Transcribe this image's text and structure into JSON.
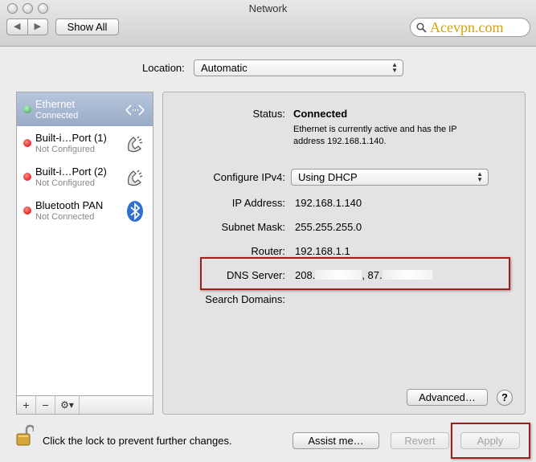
{
  "window": {
    "title": "Network",
    "back_label": "◀",
    "forward_label": "▶",
    "show_all_label": "Show All",
    "search_value": "Acevpn.com"
  },
  "location": {
    "label": "Location:",
    "value": "Automatic"
  },
  "sidebar": {
    "items": [
      {
        "name": "Ethernet",
        "status": "Connected",
        "state": "green",
        "icon": "ethernet-arrows-icon"
      },
      {
        "name": "Built-i…Port (1)",
        "status": "Not Configured",
        "state": "red",
        "icon": "phone-icon"
      },
      {
        "name": "Built-i…Port (2)",
        "status": "Not Configured",
        "state": "red",
        "icon": "phone-icon"
      },
      {
        "name": "Bluetooth PAN",
        "status": "Not Connected",
        "state": "red",
        "icon": "bluetooth-icon"
      }
    ],
    "footer": {
      "add": "+",
      "remove": "−",
      "gear": "⚙▾"
    }
  },
  "detail": {
    "status_label": "Status:",
    "status_value": "Connected",
    "status_desc_1": "Ethernet is currently active and has the IP",
    "status_desc_2": "address 192.168.1.140.",
    "configure_label": "Configure IPv4:",
    "configure_value": "Using DHCP",
    "ip_label": "IP Address:",
    "ip_value": "192.168.1.140",
    "subnet_label": "Subnet Mask:",
    "subnet_value": "255.255.255.0",
    "router_label": "Router:",
    "router_value": "192.168.1.1",
    "dns_label": "DNS Server:",
    "dns_value_a": "208.",
    "dns_value_b": ", 87.",
    "search_domains_label": "Search Domains:",
    "advanced_label": "Advanced…",
    "help_label": "?"
  },
  "bottom": {
    "lock_text": "Click the lock to prevent further changes.",
    "assist_label": "Assist me…",
    "revert_label": "Revert",
    "apply_label": "Apply"
  },
  "colors": {
    "annotation_box": "#a31c1c",
    "search_text": "#d4a20a"
  }
}
